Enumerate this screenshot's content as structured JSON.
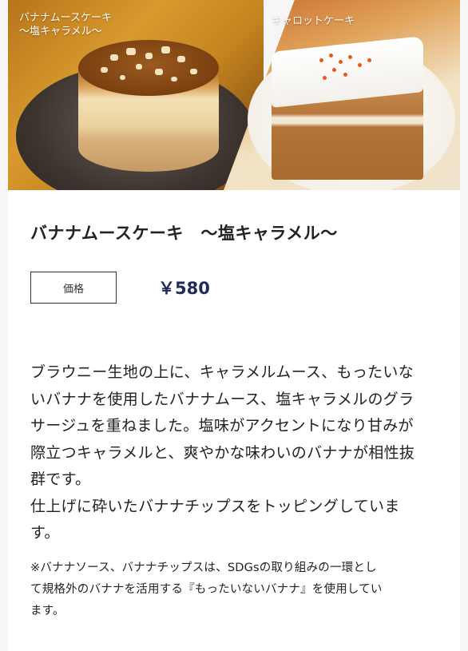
{
  "hero": {
    "left_label": "バナナムースケーキ\n〜塩キャラメル〜",
    "right_label": "キャロットケーキ"
  },
  "product": {
    "title": "バナナムースケーキ　〜塩キャラメル〜",
    "price_label": "価格",
    "price": "￥580",
    "description_lines": [
      "ブラウニー生地の上に、キャラメルムース、もったいな",
      "いバナナを使用したバナナムース、塩キャラメルのグラ",
      "サージュを重ねました。塩味がアクセントになり甘みが",
      "際立つキャラメルと、爽やかな味わいのバナナが相性抜",
      "群です。",
      "仕上げに砕いたバナナチップスをトッピングしていま",
      "す。"
    ],
    "note_lines": [
      "※バナナソース、バナナチップスは、SDGsの取り組みの一環とし",
      "て規格外のバナナを活用する『もったいないバナナ』を使用してい",
      "ます。"
    ]
  },
  "colors": {
    "price_text": "#1f2a5a",
    "background": "#f6f6f6",
    "card": "#ffffff"
  }
}
